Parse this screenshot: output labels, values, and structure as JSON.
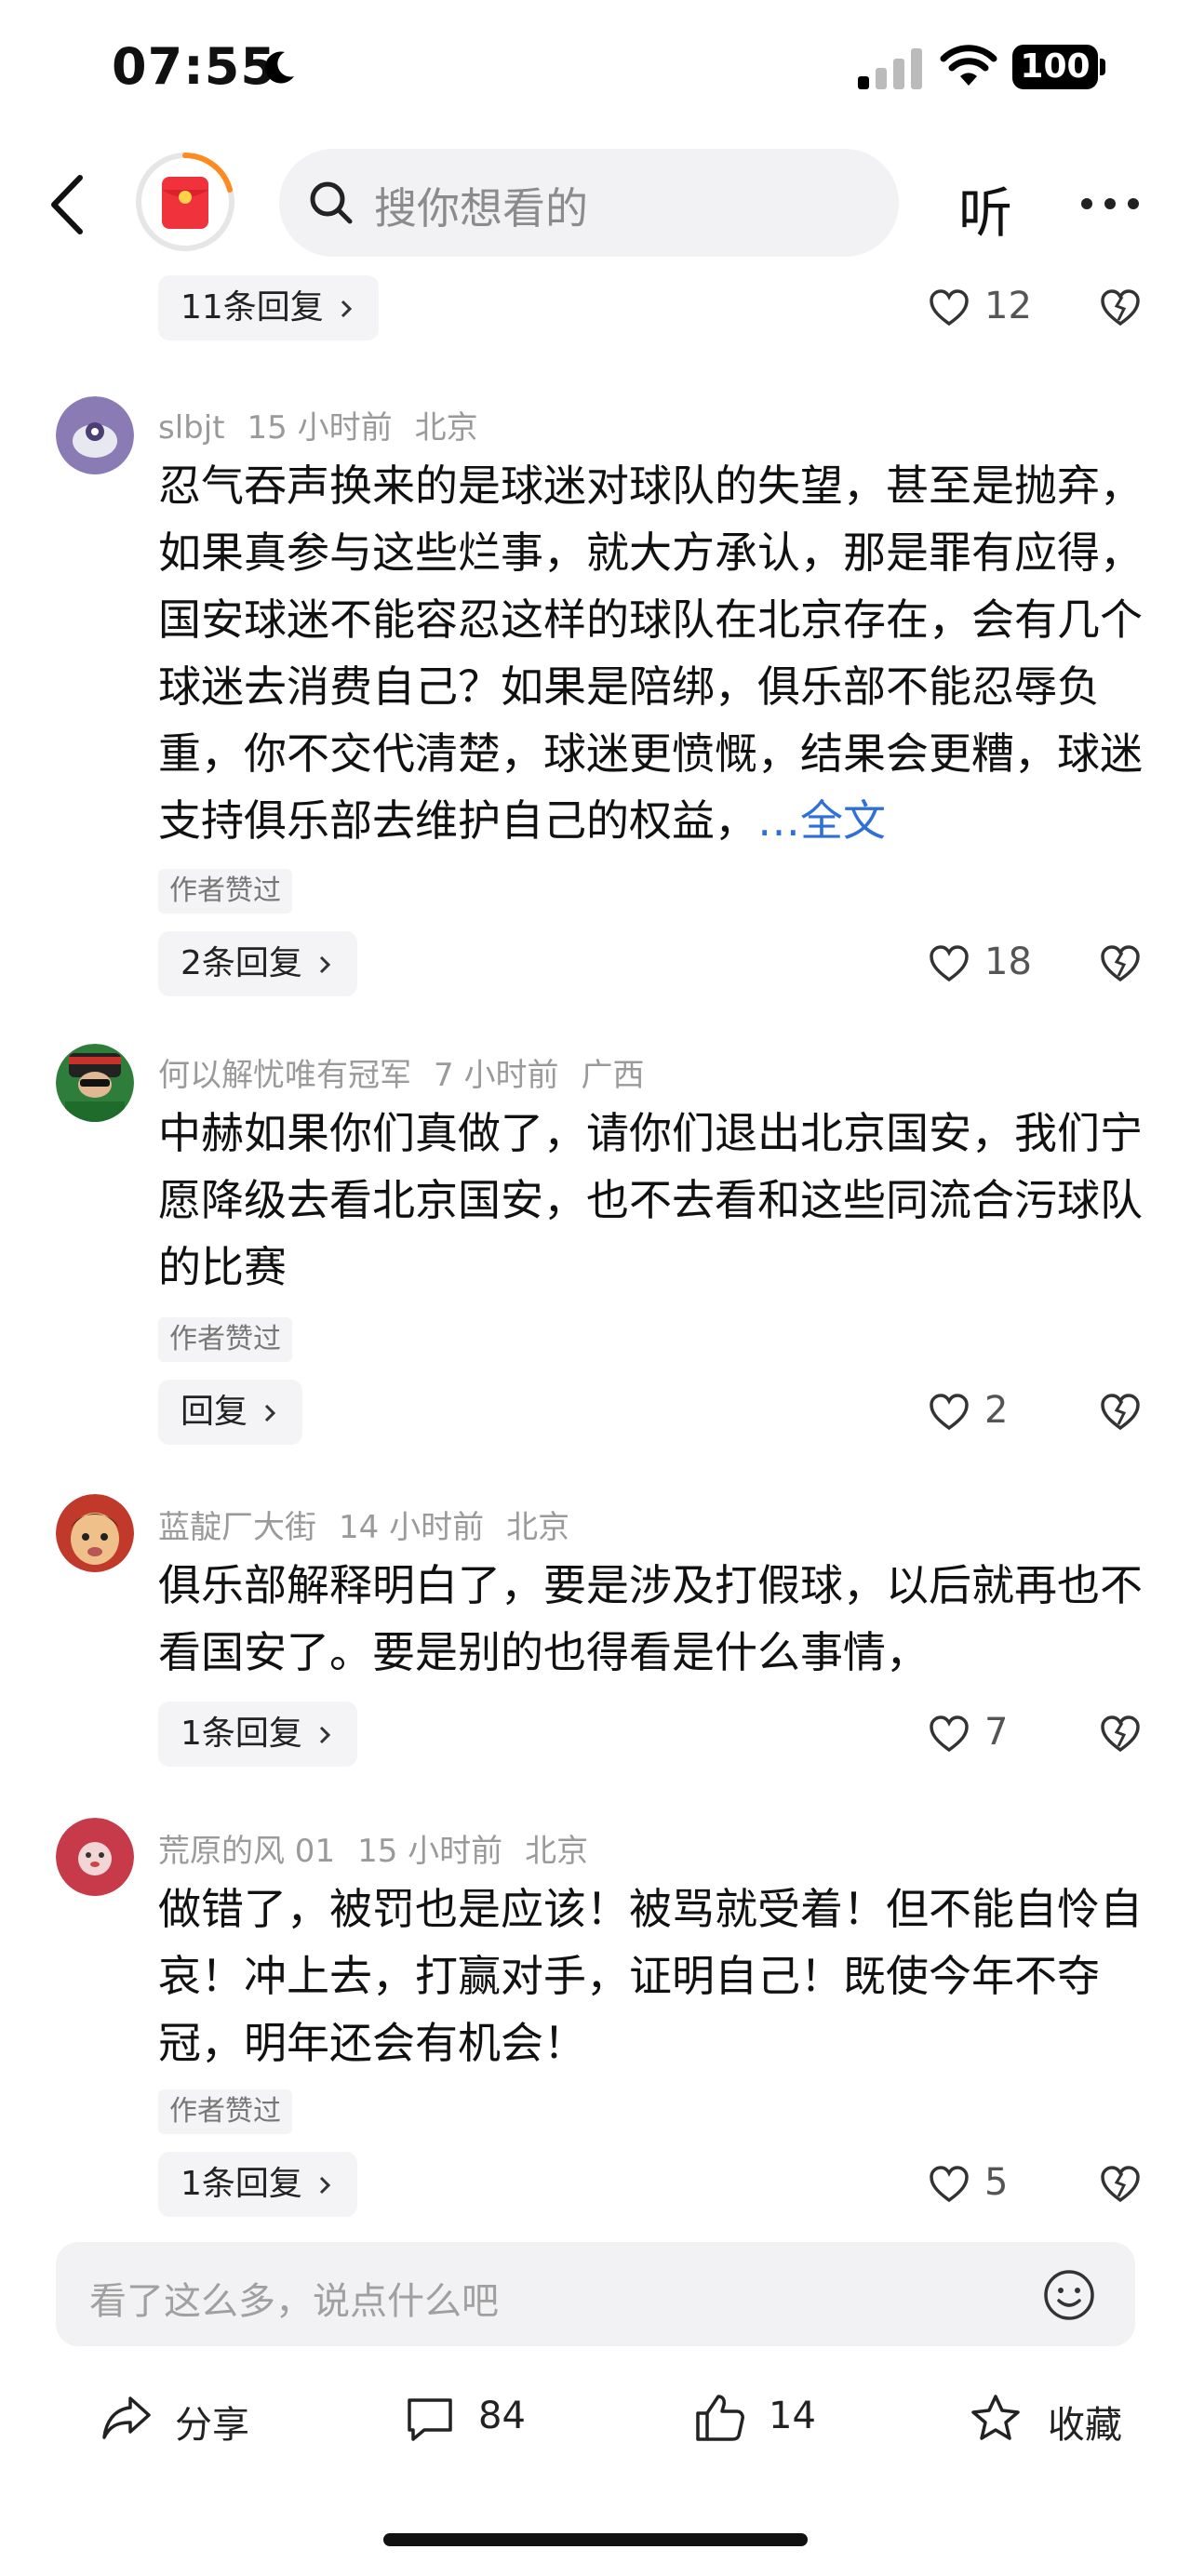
{
  "status_bar": {
    "time": "07:55",
    "battery": "100"
  },
  "nav": {
    "search_placeholder": "搜你想看的",
    "listen_label": "听"
  },
  "top_item": {
    "reply_label": "11条回复",
    "likes": "12"
  },
  "comments": [
    {
      "user": "slbjt",
      "time": "15 小时前",
      "location": "北京",
      "text": "忍气吞声换来的是球迷对球队的失望，甚至是抛弃，如果真参与这些烂事，就大方承认，那是罪有应得，国安球迷不能容忍这样的球队在北京存在，会有几个球迷去消费自己？如果是陪绑，俱乐部不能忍辱负重，你不交代清楚，球迷更愤慨，结果会更糟，球迷支持俱乐部去维护自己的权益，",
      "more_ellipsis": "…",
      "more_label": "全文",
      "author_liked": "作者赞过",
      "reply_label": "2条回复",
      "likes": "18"
    },
    {
      "user": "何以解忧唯有冠军",
      "time": "7 小时前",
      "location": "广西",
      "text": "中赫如果你们真做了，请你们退出北京国安，我们宁愿降级去看北京国安，也不去看和这些同流合污球队的比赛",
      "author_liked": "作者赞过",
      "reply_label": "回复",
      "likes": "2"
    },
    {
      "user": "蓝靛厂大街",
      "time": "14 小时前",
      "location": "北京",
      "text": "俱乐部解释明白了，要是涉及打假球，以后就再也不看国安了。要是别的也得看是什么事情，",
      "reply_label": "1条回复",
      "likes": "7"
    },
    {
      "user": "荒原的风 01",
      "time": "15 小时前",
      "location": "北京",
      "text": "做错了，被罚也是应该！被骂就受着！但不能自怜自哀！冲上去，打赢对手，证明自己！既使今年不夺冠，明年还会有机会！",
      "author_liked": "作者赞过",
      "reply_label": "1条回复",
      "likes": "5"
    }
  ],
  "bottom_bar": {
    "comment_placeholder": "看了这么多，说点什么吧",
    "share_label": "分享",
    "comment_count": "84",
    "like_count": "14",
    "favorite_label": "收藏"
  }
}
